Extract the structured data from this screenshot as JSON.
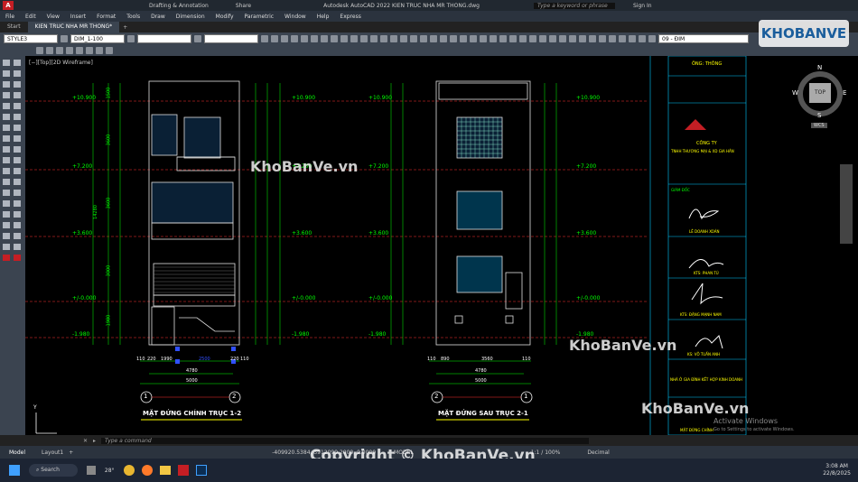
{
  "window": {
    "quick_access": "Drafting & Annotation",
    "share": "Share",
    "title": "Autodesk AutoCAD 2022   KIEN TRUC NHA MR THONG.dwg",
    "search_placeholder": "Type a keyword or phrase",
    "sign_in": "Sign In",
    "layer_quick": "09 - ĐIM"
  },
  "menu": [
    "File",
    "Edit",
    "View",
    "Insert",
    "Format",
    "Tools",
    "Draw",
    "Dimension",
    "Modify",
    "Parametric",
    "Window",
    "Help",
    "Express"
  ],
  "tabs": {
    "start": "Start",
    "doc": "KIEN TRUC NHA MR THONG*"
  },
  "props": {
    "text_style": "STYLE3",
    "dim_style": "DIM_1-100",
    "layer": "09 - ĐIM"
  },
  "viewport_label": "[−][Top][2D Wireframe]",
  "viewcube": {
    "n": "N",
    "s": "S",
    "e": "E",
    "w": "W",
    "top": "TOP",
    "wcs": "WCS"
  },
  "drawing": {
    "front": {
      "title": "MẶT ĐỨNG CHÍNH TRỤC 1-2",
      "axis_left": "1",
      "axis_right": "2",
      "dims_bottom": [
        "110",
        "220",
        "1990",
        "2500",
        "220",
        "110"
      ],
      "dim_total_inner": "4780",
      "dim_total": "5000",
      "levels": [
        "+10.900",
        "+7.200",
        "+3.600",
        "+/-0.000",
        "-1.980"
      ],
      "heights_left": [
        "1500",
        "3600",
        "14280",
        "3600",
        "3000",
        "1980"
      ]
    },
    "rear": {
      "title": "MẶT ĐỨNG SAU TRỤC 2-1",
      "axis_left": "2",
      "axis_right": "1",
      "dims_bottom": [
        "110",
        "890",
        "3560",
        "110"
      ],
      "dim_total_inner": "4780",
      "dim_total": "5000",
      "levels": [
        "+10.900",
        "+7.200",
        "+3.600",
        "+/-0.000",
        "-1.980"
      ]
    },
    "titleblock": {
      "owner_label": "ÔNG: THÔNG",
      "company": "CÔNG TY",
      "company_name": "TNHH THƯƠNG MẠI & XD GIA HÂN",
      "director_role": "GIÁM ĐỐC",
      "director": "LÊ DOANH XOÁN",
      "chief": "KTS: PHAN TÚ",
      "designer": "KTS: ĐẶNG MẠNH NAM",
      "drafter": "KS: VÕ TUẤN ANH",
      "project": "NHÀ Ở GIA ĐÌNH KẾT HỢP KINH DOANH",
      "drawing_name": "MẶT ĐỨNG CHÍNH"
    }
  },
  "command": {
    "placeholder": "Type a command"
  },
  "layout_tabs": [
    "Model",
    "Layout1"
  ],
  "status": {
    "coords": "-409920.5384, 3912099.2000, 0.0000",
    "model": "MODEL",
    "scale": "1:1 / 100%",
    "units": "Decimal"
  },
  "activate": {
    "line1": "Activate Windows",
    "line2": "Go to Settings to activate Windows."
  },
  "taskbar": {
    "search": "Search",
    "temp": "28°",
    "time": "3:08 AM",
    "date": "22/8/2025"
  },
  "watermarks": {
    "mark": "KhoBanVe.vn",
    "copyright": "Copyright © KhoBanVe.vn",
    "logo": "KHOBANVE"
  },
  "colors": {
    "dim_green": "#00ff00",
    "level_red": "#ff3030",
    "axis_yellow": "#ffff00",
    "frame_cyan": "#00c8ff",
    "bg": "#000000"
  }
}
